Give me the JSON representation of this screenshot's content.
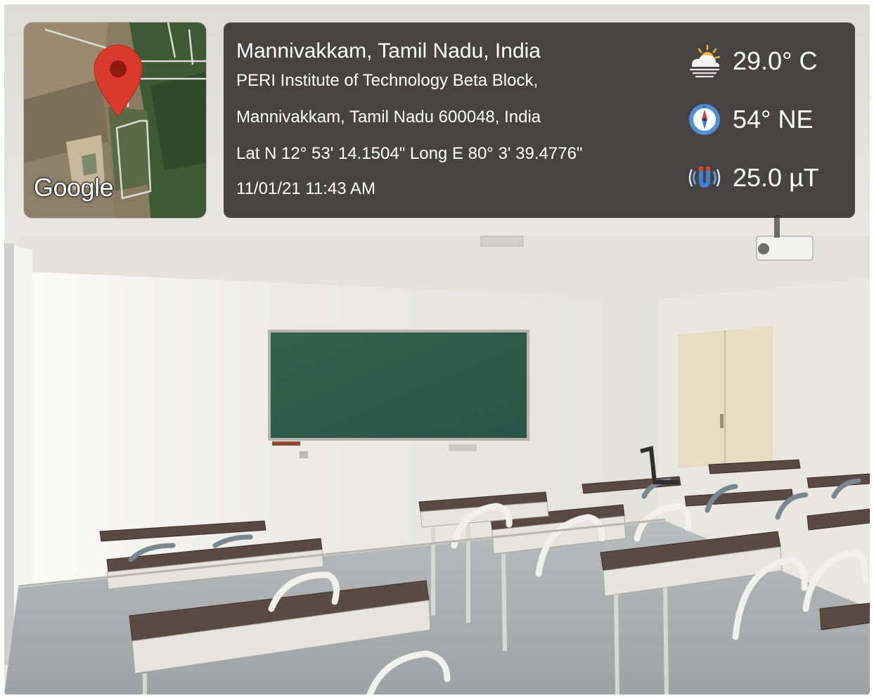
{
  "overlay": {
    "map": {
      "provider_label": "Google",
      "pin_icon": "location-pin-icon",
      "pin_color": "#d93a2b"
    },
    "location": {
      "title": "Mannivakkam, Tamil Nadu, India",
      "address_line1": "PERI Institute of Technology Beta Block,",
      "address_line2": "Mannivakkam, Tamil Nadu 600048, India",
      "coordinates": "Lat N 12° 53' 14.1504\" Long E 80° 3' 39.4776\"",
      "timestamp": "11/01/21 11:43 AM"
    },
    "metrics": [
      {
        "icon": "weather-partly-cloudy-icon",
        "value": "29.0° C"
      },
      {
        "icon": "compass-icon",
        "value": "54° NE"
      },
      {
        "icon": "magnetic-field-icon",
        "value": "25.0 µT"
      }
    ],
    "panel_color": "#3a3837"
  },
  "scene": {
    "description_icon": "classroom-photo",
    "board_color": "#2f5b4e",
    "wall_color": "#efeeea"
  }
}
